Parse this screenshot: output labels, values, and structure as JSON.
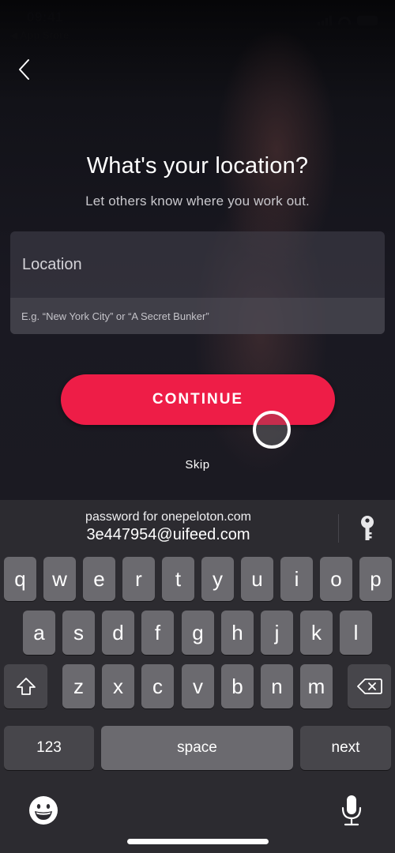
{
  "status_bar": {
    "time": "09:41",
    "back_to_app": "◀ App Store"
  },
  "header": {
    "back_icon": "chevron-left-icon"
  },
  "content": {
    "title": "What's your location?",
    "subtitle": "Let others know where you work out.",
    "location_input": {
      "placeholder": "Location",
      "value": "",
      "hint": "E.g. “New York City” or “A Secret Bunker”"
    },
    "continue_label": "CONTINUE",
    "skip_label": "Skip"
  },
  "colors": {
    "accent": "#ee1d47",
    "background": "#17161d",
    "keyboard": "#2c2b30",
    "key": "#6b6a6f",
    "key_dark": "#47464b"
  },
  "keyboard": {
    "suggestion": {
      "line1": "password for onepeloton.com",
      "line2": "3e447954@uifeed.com",
      "icon": "key-icon"
    },
    "row1": [
      "q",
      "w",
      "e",
      "r",
      "t",
      "y",
      "u",
      "i",
      "o",
      "p"
    ],
    "row2": [
      "a",
      "s",
      "d",
      "f",
      "g",
      "h",
      "j",
      "k",
      "l"
    ],
    "row3": [
      "z",
      "x",
      "c",
      "v",
      "b",
      "n",
      "m"
    ],
    "shift_icon": "shift-icon",
    "delete_icon": "backspace-icon",
    "numbers_label": "123",
    "space_label": "space",
    "next_label": "next",
    "emoji_icon": "emoji-icon",
    "mic_icon": "microphone-icon"
  }
}
